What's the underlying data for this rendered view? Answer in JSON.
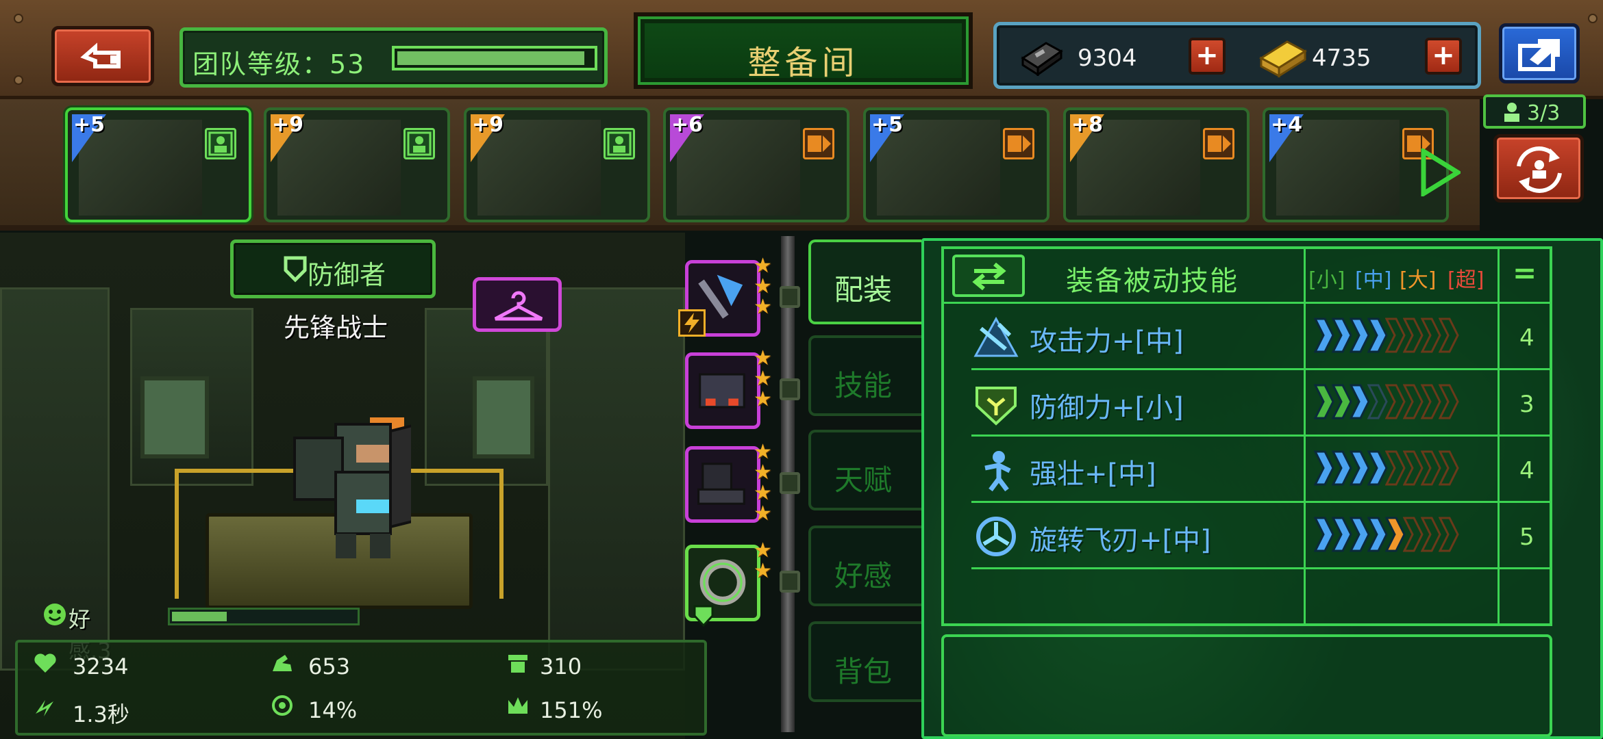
{
  "header": {
    "team_level_label": "团队等级：53",
    "team_level_progress": 0.96,
    "title": "整备间",
    "currency": [
      {
        "icon": "steel-bar-icon",
        "value": "9304"
      },
      {
        "icon": "gold-bar-icon",
        "value": "4735"
      }
    ]
  },
  "roster": {
    "heroes": [
      {
        "level": "+5",
        "rank_color": "#3a7ae8",
        "role": "defender",
        "badge": "green",
        "selected": true
      },
      {
        "level": "+9",
        "rank_color": "#e89a2a",
        "role": "defender",
        "badge": "green",
        "selected": false
      },
      {
        "level": "+9",
        "rank_color": "#e89a2a",
        "role": "defender",
        "badge": "green",
        "selected": false
      },
      {
        "level": "+6",
        "rank_color": "#b84ad8",
        "role": "dps",
        "badge": "orange",
        "selected": false
      },
      {
        "level": "+5",
        "rank_color": "#3a7ae8",
        "role": "dps",
        "badge": "orange",
        "selected": false
      },
      {
        "level": "+8",
        "rank_color": "#e89a2a",
        "role": "dps",
        "badge": "orange",
        "selected": false
      },
      {
        "level": "+4",
        "rank_color": "#3a7ae8",
        "role": "dps",
        "badge": "orange",
        "selected": false
      }
    ],
    "team_count": "3/3"
  },
  "hero": {
    "class_label": "防御者",
    "name": "先锋战士",
    "affinity_label": "好感.3",
    "affinity_progress": 0.3,
    "stats": {
      "hp": "3234",
      "attack": "653",
      "defense": "310",
      "attack_speed": "1.3秒",
      "crit": "14%",
      "crit_damage": "151%"
    }
  },
  "equipment": [
    {
      "icon": "axe-icon",
      "stars": 3,
      "frame": "purple",
      "has_bolt": true
    },
    {
      "icon": "armor-vest-icon",
      "stars": 3,
      "frame": "purple",
      "has_bolt": false
    },
    {
      "icon": "boots-icon",
      "stars": 4,
      "frame": "purple",
      "has_bolt": false
    },
    {
      "icon": "ring-icon",
      "stars": 2,
      "frame": "green",
      "has_bolt": false
    }
  ],
  "tabs": [
    "配装",
    "技能",
    "天赋",
    "好感",
    "背包"
  ],
  "active_tab": 0,
  "skills": {
    "title": "装备被动技能",
    "levels": [
      {
        "label": "[小]",
        "color": "#4ab840"
      },
      {
        "label": "[中]",
        "color": "#4aa2f0"
      },
      {
        "label": "[大]",
        "color": "#f0962a"
      },
      {
        "label": "[超]",
        "color": "#e84a3a"
      }
    ],
    "total_symbol": "=",
    "rows": [
      {
        "name": "攻击力+[中]",
        "icon": "attack-icon",
        "points": 4,
        "count": "4",
        "color": "#6ab8f8"
      },
      {
        "name": "防御力+[小]",
        "icon": "defense-icon",
        "points": 3,
        "count": "3",
        "color": "#6ab8f8"
      },
      {
        "name": "强壮+[中]",
        "icon": "strength-icon",
        "points": 4,
        "count": "4",
        "color": "#6ab8f8"
      },
      {
        "name": "旋转飞刃+[中]",
        "icon": "spin-blade-icon",
        "points": 5,
        "count": "5",
        "color": "#6ab8f8"
      }
    ]
  }
}
